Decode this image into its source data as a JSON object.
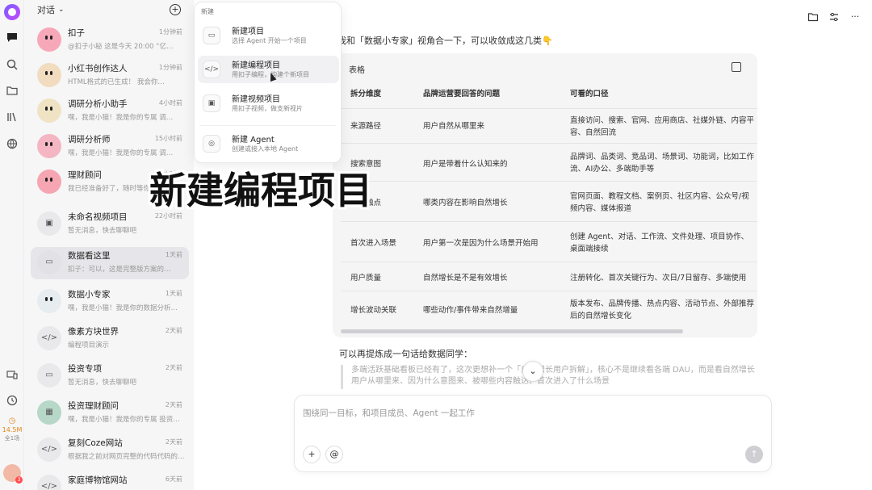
{
  "sidebar": {
    "title": "对话",
    "counter": {
      "value": "14.5M",
      "sub": "全1场"
    },
    "items": [
      {
        "name": "扣子",
        "time": "1分钟前",
        "msg": "@扣子小秘 这是今天 20:00 “亿…",
        "avatar_color": "#f7a8b8"
      },
      {
        "name": "小红书创作达人",
        "time": "1分钟前",
        "msg": "HTML格式的已生成！ 我会你…",
        "avatar_color": "#f1dcc0"
      },
      {
        "name": "调研分析小助手",
        "time": "4小时前",
        "msg": "嘿，我是小猫！我是你的专属 调…",
        "avatar_color": "#efe3c4"
      },
      {
        "name": "调研分析师",
        "time": "15小时前",
        "msg": "嘿，我是小猫！我是你的专属 调…",
        "avatar_color": "#f4b6c2"
      },
      {
        "name": "理财顾问",
        "time": "15小时前",
        "msg": "我已经准备好了，随时等你…",
        "avatar_color": "#f6a6b2"
      },
      {
        "name": "未命名视频项目",
        "time": "22小时前",
        "msg": "暂无消息，快去聊聊吧",
        "avatar_color": "#e9e9ec"
      },
      {
        "name": "数据看这里",
        "time": "1天前",
        "msg": "扣子：可以，这是完整版方案的…",
        "avatar_color": "#e2e2e6"
      },
      {
        "name": "数据小专家",
        "time": "1天前",
        "msg": "嘿，我是小猫！我是你的数据分析…",
        "avatar_color": "#e6ecef"
      },
      {
        "name": "像素方块世界",
        "time": "2天前",
        "msg": "编程项目演示",
        "avatar_color": "#e9e9ec"
      },
      {
        "name": "投资专项",
        "time": "2天前",
        "msg": "暂无消息，快去聊聊吧",
        "avatar_color": "#e9e9ec"
      },
      {
        "name": "投资理财顾问",
        "time": "2天前",
        "msg": "嘿，我是小猫！我是你的专属 投资…",
        "avatar_color": "#b7d8c9"
      },
      {
        "name": "复刻Coze网站",
        "time": "2天前",
        "msg": "根据我之前对网页完整的代码代码的…",
        "avatar_color": "#e9e9ec"
      },
      {
        "name": "家庭博物馆网站",
        "time": "6天前",
        "msg": "",
        "avatar_color": "#e9e9ec"
      }
    ]
  },
  "new_menu": {
    "header": "新建",
    "items": [
      {
        "title": "新建项目",
        "desc": "选择 Agent 开始一个项目",
        "icon": "project-icon"
      },
      {
        "title": "新建编程项目",
        "desc": "用扣子编程，构建个新项目",
        "icon": "code-icon"
      },
      {
        "title": "新建视频项目",
        "desc": "用扣子视频，做支新视片",
        "icon": "clapper-icon"
      },
      {
        "title": "新建 Agent",
        "desc": "创建或接入本地 Agent",
        "icon": "bot-icon"
      }
    ]
  },
  "chat": {
    "intro": "我和「数据小专家」视角合一下，可以收敛成这几类👇",
    "table_title": "表格",
    "headers": [
      "拆分维度",
      "品牌运营要回答的问题",
      "可看的口径"
    ],
    "rows": [
      [
        "来源路径",
        "用户自然从哪里来",
        "直接访问、搜索、官网、应用商店、社媒外链、内容平",
        "容、自然回流"
      ],
      [
        "搜索意图",
        "用户是带着什么认知来的",
        "品牌词、品类词、竞品词、场景词、功能词，比如工作",
        "流、AI办公、多端助手等"
      ],
      [
        "内容触点",
        "哪类内容在影响自然增长",
        "官网页面、教程文档、案例页、社区内容、公众号/视",
        "频内容、媒体报道"
      ],
      [
        "首次进入场景",
        "用户第一次是因为什么场景开始用",
        "创建 Agent、对话、工作流、文件处理、项目协作、",
        "桌面端接续"
      ],
      [
        "用户质量",
        "自然增长是不是有效增长",
        "注册转化、首次关键行为、次日/7日留存、多端使用",
        ""
      ],
      [
        "增长波动关联",
        "哪些动作/事件带来自然增量",
        "版本发布、品牌传播、热点内容、活动节点、外部推荐",
        "后的自然增长变化"
      ]
    ],
    "after_text": "可以再提炼成一句话给数据同学：",
    "quote": "多端活跃基础看板已经有了，这次更想补一个「自然增长用户拆解」，核心不是继续看各端 DAU，而是看自然增长用户从哪里来、因为什么意图来、被哪些内容触达、首次进入了什么场景"
  },
  "composer": {
    "placeholder": "围绕同一目标，和项目成员、Agent 一起工作"
  },
  "overlay_caption": "新建编程项目"
}
